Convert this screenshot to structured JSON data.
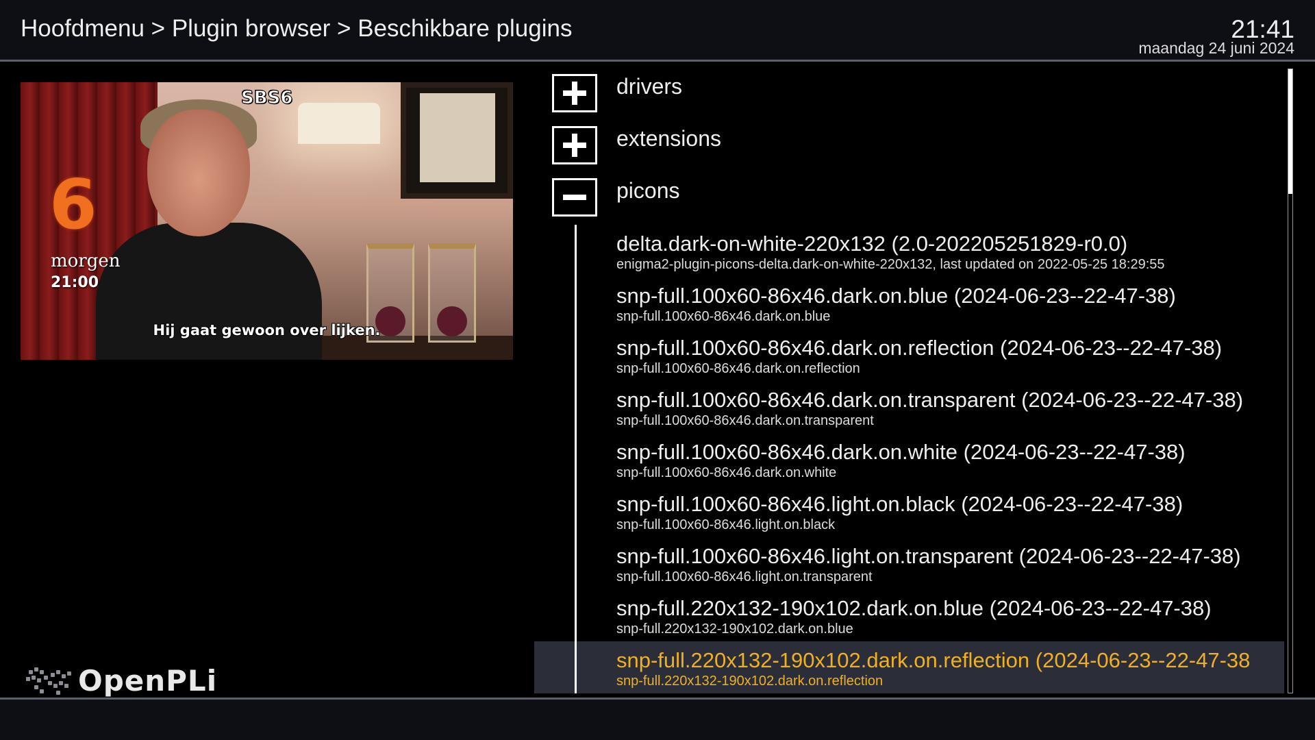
{
  "header": {
    "breadcrumb": "Hoofdmenu > Plugin browser > Beschikbare plugins",
    "time": "21:41",
    "date": "maandag 24 juni 2024"
  },
  "preview": {
    "channel_name": "SBS6",
    "logo_digit": "6",
    "promo_day": "morgen",
    "promo_time": "21:00",
    "subtitle": "Hij gaat gewoon over lijken."
  },
  "brand": {
    "name": "OpenPLi"
  },
  "categories": [
    {
      "label": "drivers",
      "state": "collapsed",
      "icon": "plus-icon"
    },
    {
      "label": "extensions",
      "state": "collapsed",
      "icon": "plus-icon"
    },
    {
      "label": "picons",
      "state": "expanded",
      "icon": "minus-icon"
    }
  ],
  "items": [
    {
      "title": "delta.dark-on-white-220x132  (2.0-202205251829-r0.0)",
      "subtitle": "enigma2-plugin-picons-delta.dark-on-white-220x132, last updated on 2022-05-25 18:29:55"
    },
    {
      "title": "snp-full.100x60-86x46.dark.on.blue  (2024-06-23--22-47-38)",
      "subtitle": "snp-full.100x60-86x46.dark.on.blue"
    },
    {
      "title": "snp-full.100x60-86x46.dark.on.reflection  (2024-06-23--22-47-38)",
      "subtitle": "snp-full.100x60-86x46.dark.on.reflection"
    },
    {
      "title": "snp-full.100x60-86x46.dark.on.transparent  (2024-06-23--22-47-38)",
      "subtitle": "snp-full.100x60-86x46.dark.on.transparent"
    },
    {
      "title": "snp-full.100x60-86x46.dark.on.white  (2024-06-23--22-47-38)",
      "subtitle": "snp-full.100x60-86x46.dark.on.white"
    },
    {
      "title": "snp-full.100x60-86x46.light.on.black  (2024-06-23--22-47-38)",
      "subtitle": "snp-full.100x60-86x46.light.on.black"
    },
    {
      "title": "snp-full.100x60-86x46.light.on.transparent  (2024-06-23--22-47-38)",
      "subtitle": "snp-full.100x60-86x46.light.on.transparent"
    },
    {
      "title": "snp-full.220x132-190x102.dark.on.blue  (2024-06-23--22-47-38)",
      "subtitle": "snp-full.220x132-190x102.dark.on.blue"
    },
    {
      "title": "snp-full.220x132-190x102.dark.on.reflection  (2024-06-23--22-47-38",
      "subtitle": "snp-full.220x132-190x102.dark.on.reflection",
      "selected": true
    }
  ],
  "colors": {
    "background": "#000000",
    "bar": "#0e0f14",
    "selection": "#2b2e38",
    "selected_text": "#f0b020",
    "text": "#eeeeee"
  }
}
